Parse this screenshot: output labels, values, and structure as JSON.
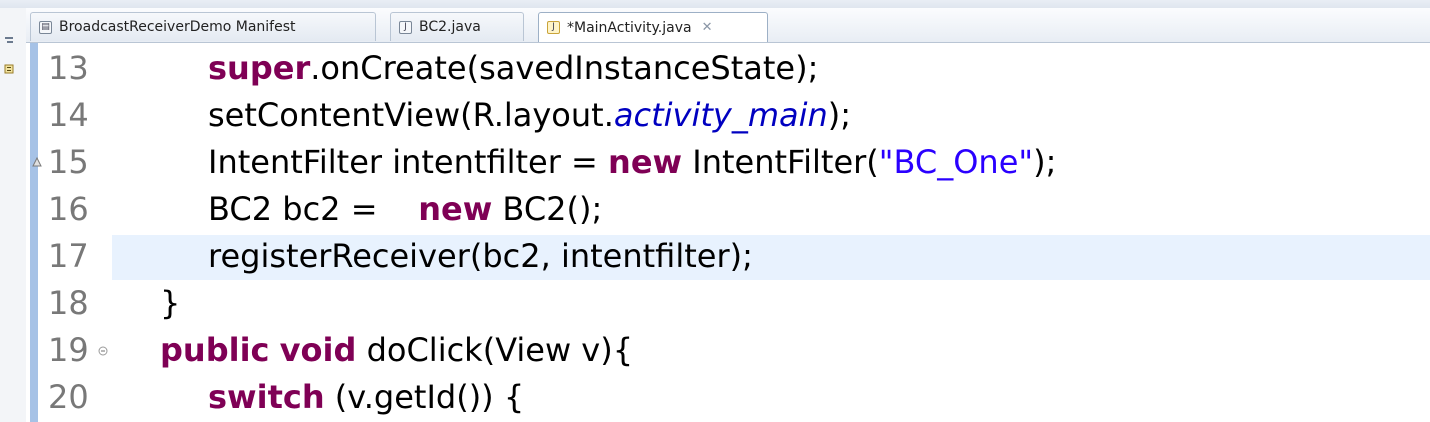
{
  "tabs": [
    {
      "label": "BroadcastReceiverDemo Manifest",
      "icon": "manifest-icon",
      "active": false
    },
    {
      "label": "BC2.java",
      "icon": "java-file-icon",
      "active": false
    },
    {
      "label": "*MainActivity.java",
      "icon": "java-file-icon",
      "active": true,
      "close": "✕"
    }
  ],
  "editor": {
    "lines": [
      {
        "num": "13"
      },
      {
        "num": "14"
      },
      {
        "num": "15"
      },
      {
        "num": "16"
      },
      {
        "num": "17"
      },
      {
        "num": "18"
      },
      {
        "num": "19"
      },
      {
        "num": "20"
      }
    ],
    "code": {
      "l13_kw": "super",
      "l13_rest": ".onCreate(savedInstanceState);",
      "l14_a": "setContentView(R.layout.",
      "l14_field": "activity_main",
      "l14_b": ");",
      "l15_a": "IntentFilter intentfilter = ",
      "l15_kw": "new",
      "l15_b": " IntentFilter(",
      "l15_str": "\"BC_One\"",
      "l15_c": ");",
      "l16_a": "BC2 bc2 =    ",
      "l16_kw": "new",
      "l16_b": " BC2();",
      "l17": "registerReceiver(bc2, intentfilter);",
      "l18": "}",
      "l19_kw1": "public",
      "l19_kw2": "void",
      "l19_rest": " doClick(View v){",
      "l20_kw": "switch",
      "l20_rest": " (v.getId()) {"
    },
    "current_line": "17",
    "colors": {
      "keyword": "#7f0055",
      "string": "#2a00ff",
      "field": "#0000c0",
      "line_number": "#787878",
      "current_line_bg": "#e8f2fe",
      "ruler": "#a6c2e6"
    }
  }
}
